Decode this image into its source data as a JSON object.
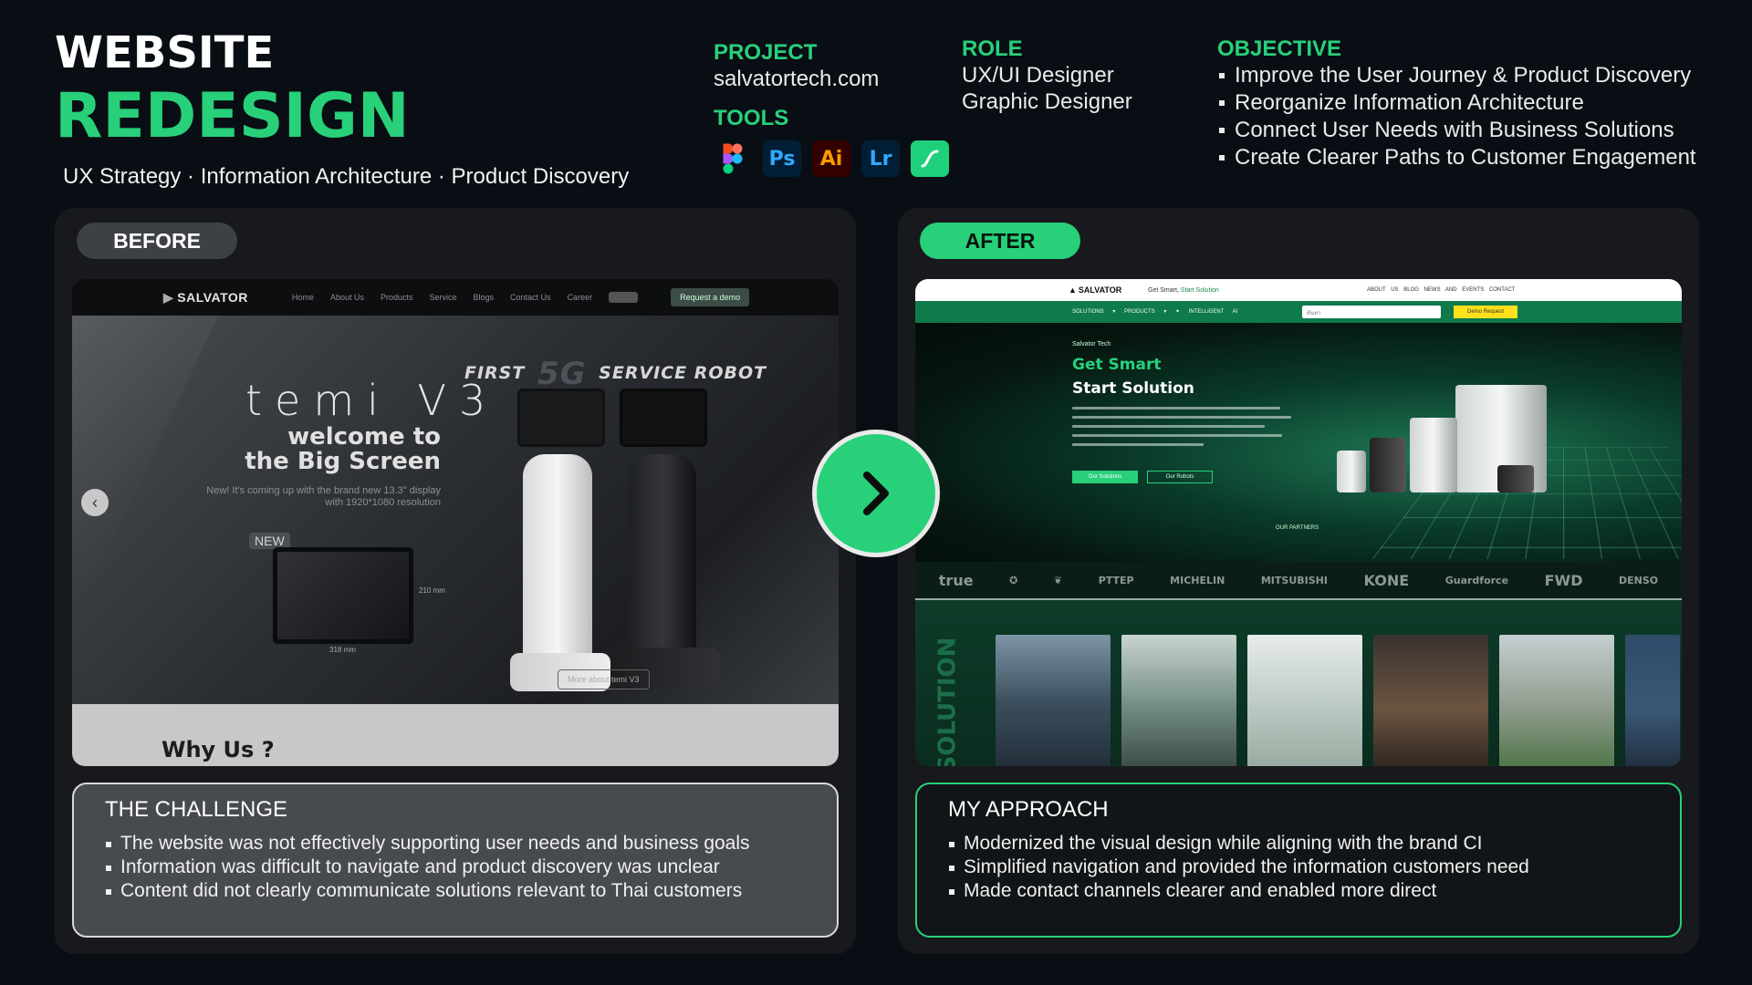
{
  "header": {
    "title_line1": "WEBSITE",
    "title_line2": "REDESIGN",
    "subtitle": "UX Strategy · Information Architecture · Product Discovery"
  },
  "project": {
    "heading": "PROJECT",
    "value": "salvatortech.com"
  },
  "tools": {
    "heading": "TOOLS",
    "items": [
      "figma-icon",
      "Ps",
      "Ai",
      "Lr",
      "sw-icon"
    ]
  },
  "role": {
    "heading": "ROLE",
    "lines": [
      "UX/UI Designer",
      "Graphic Designer"
    ]
  },
  "objective": {
    "heading": "OBJECTIVE",
    "items": [
      "Improve the User Journey & Product Discovery",
      "Reorganize Information Architecture",
      "Connect User Needs with Business Solutions",
      "Create Clearer Paths to Customer Engagement"
    ]
  },
  "before": {
    "label": "BEFORE",
    "site": {
      "logo": "SALVATOR",
      "nav": [
        "Home",
        "About Us",
        "Products",
        "Service",
        "Blogs",
        "Contact Us",
        "Career"
      ],
      "cta": "Request a demo",
      "headline_prefix": "FIRST",
      "headline_5g": "5G",
      "headline_suffix": "SERVICE ROBOT",
      "product": "temi V3",
      "welcome": "welcome to the Big Screen",
      "small": "New! It's coming up with the brand new 13.3\" display with 1920*1080 resolution",
      "new_badge": "NEW",
      "dim_height": "210 mm",
      "dim_width": "318 mm",
      "more": "More about temi V3",
      "why_us": "Why Us ?"
    },
    "challenge": {
      "title": "THE CHALLENGE",
      "items": [
        "The website was not effectively supporting user needs and business goals",
        "Information was difficult to navigate and product discovery was unclear",
        "Content did not clearly communicate solutions relevant to Thai customers"
      ]
    }
  },
  "after": {
    "label": "AFTER",
    "site": {
      "logo": "SALVATOR",
      "tagline_prefix": "Get Smart,",
      "tagline_accent": "Start Solution",
      "nav": "ABOUT US  BLOG  NEWS AND EVENTS  CONTACT",
      "subnav": "SOLUTIONS ▾  PRODUCTS ▾  ✦ INTELLIGENT AI",
      "search_placeholder": "ค้นหา",
      "demo": "Demo Request",
      "kicker": "Salvator Tech",
      "h1": "Get Smart",
      "h2": "Start Solution",
      "btn_solutions": "Our Solutions",
      "btn_robots": "Our Robots",
      "partners_label": "OUR PARTNERS",
      "partners": [
        "true",
        "Mercedes-Benz",
        "crest",
        "PTTEP",
        "MICHELIN",
        "MITSUBISHI",
        "KONE",
        "Guardforce",
        "FWD",
        "DENSO"
      ],
      "solution_label": "SOLUTION"
    },
    "approach": {
      "title": "MY APPROACH",
      "items": [
        "Modernized the visual design while aligning with the brand CI",
        "Simplified navigation and provided the information customers need",
        "Made contact channels clearer and enabled more direct"
      ]
    }
  },
  "colors": {
    "accent": "#28d07a",
    "background": "#090e14",
    "panel": "#17191c"
  }
}
